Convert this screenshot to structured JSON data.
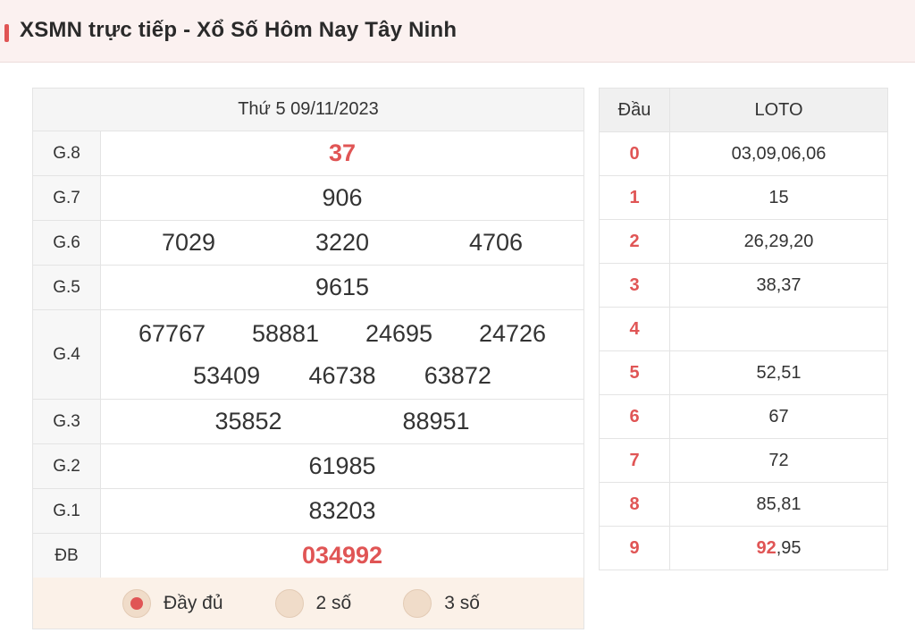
{
  "header": {
    "title": "XSMN trực tiếp - Xổ Số Hôm Nay Tây Ninh"
  },
  "result": {
    "date": "Thứ 5 09/11/2023",
    "prizes": [
      {
        "label": "G.8",
        "numbers": [
          "37"
        ]
      },
      {
        "label": "G.7",
        "numbers": [
          "906"
        ]
      },
      {
        "label": "G.6",
        "numbers": [
          "7029",
          "3220",
          "4706"
        ]
      },
      {
        "label": "G.5",
        "numbers": [
          "9615"
        ]
      },
      {
        "label": "G.4",
        "numbers": [
          "67767",
          "58881",
          "24695",
          "24726",
          "53409",
          "46738",
          "63872"
        ]
      },
      {
        "label": "G.3",
        "numbers": [
          "35852",
          "88951"
        ]
      },
      {
        "label": "G.2",
        "numbers": [
          "61985"
        ]
      },
      {
        "label": "G.1",
        "numbers": [
          "83203"
        ]
      },
      {
        "label": "ĐB",
        "numbers": [
          "034992"
        ]
      }
    ]
  },
  "options": [
    {
      "label": "Đầy đủ",
      "selected": true
    },
    {
      "label": "2 số",
      "selected": false
    },
    {
      "label": "3 số",
      "selected": false
    }
  ],
  "loto": {
    "header_dau": "Đầu",
    "header_loto": "LOTO",
    "rows": [
      {
        "dau": "0",
        "values": "03,09,06,06"
      },
      {
        "dau": "1",
        "values": "15"
      },
      {
        "dau": "2",
        "values": "26,29,20"
      },
      {
        "dau": "3",
        "values": "38,37"
      },
      {
        "dau": "4",
        "values": ""
      },
      {
        "dau": "5",
        "values": "52,51"
      },
      {
        "dau": "6",
        "values": "67"
      },
      {
        "dau": "7",
        "values": "72"
      },
      {
        "dau": "8",
        "values": "85,81"
      },
      {
        "dau": "9",
        "values_highlight": "92",
        "values_rest": ",95"
      }
    ]
  },
  "colors": {
    "accent": "#e05555",
    "header_bg": "#fbf1f0",
    "options_bg": "#fbf1e8"
  }
}
